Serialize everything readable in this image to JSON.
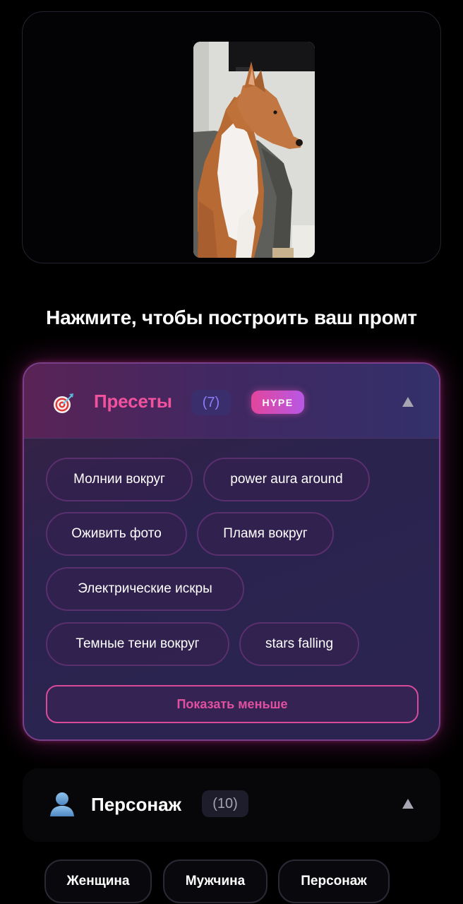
{
  "page": {
    "title": "Нажмите, чтобы построить ваш промт"
  },
  "photo": {
    "description_icon": "uploaded-photo"
  },
  "presets": {
    "icon": "dart-target-icon",
    "title": "Пресеты",
    "count": "(7)",
    "badge": "HYPE",
    "items": [
      {
        "label": "Молнии вокруг"
      },
      {
        "label": "power aura around"
      },
      {
        "label": "Оживить фото"
      },
      {
        "label": "Пламя вокруг"
      },
      {
        "label": "Электрические искры"
      },
      {
        "label": "Темные тени вокруг"
      },
      {
        "label": "stars falling"
      }
    ],
    "show_less_label": "Показать меньше"
  },
  "character": {
    "icon": "person-silhouette-icon",
    "title": "Персонаж",
    "count": "(10)",
    "items": [
      {
        "label": "Женщина"
      },
      {
        "label": "Мужчина"
      },
      {
        "label": "Персонаж"
      }
    ]
  },
  "colors": {
    "accent_pink": "#f0529d",
    "accent_purple": "#8d7dfa",
    "background": "#000000"
  }
}
